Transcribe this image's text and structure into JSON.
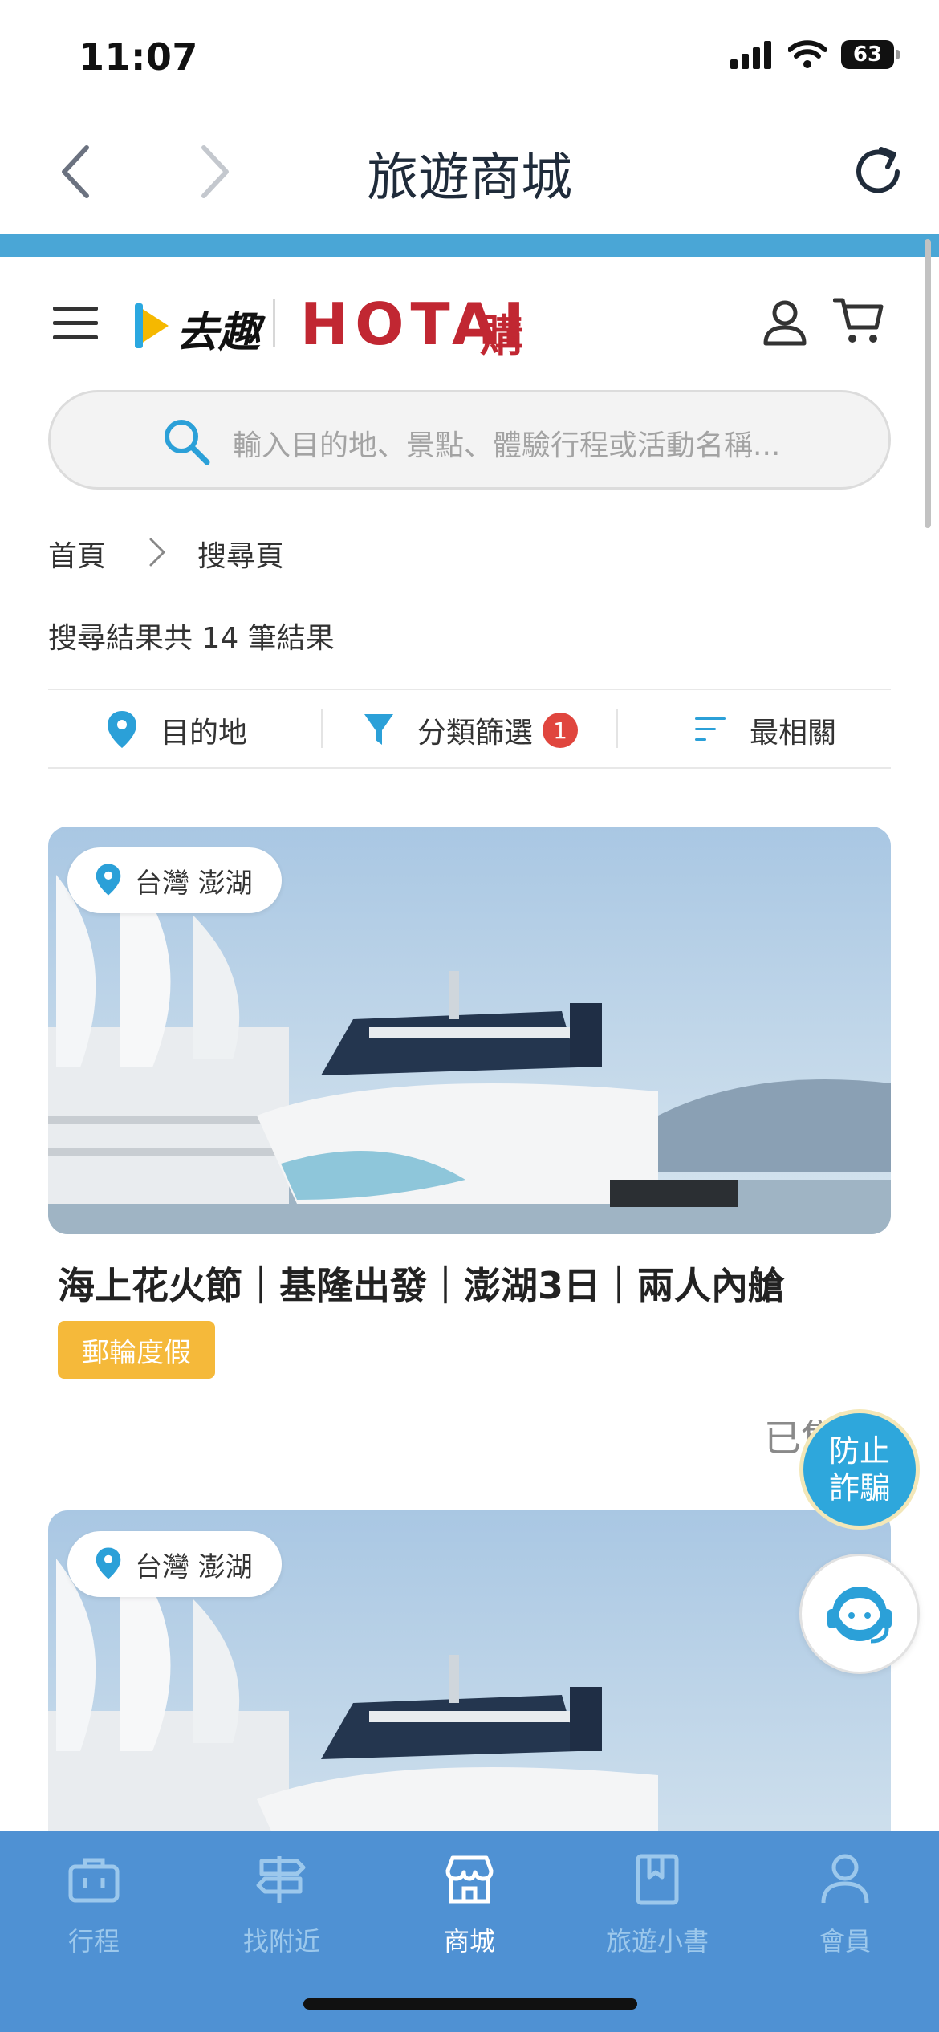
{
  "status_bar": {
    "time": "11:07",
    "battery": "63"
  },
  "nav": {
    "title": "旅遊商城"
  },
  "header": {
    "logo_qq": "去趣",
    "logo_hotai": "HOTAI",
    "logo_hotai_suffix": "購"
  },
  "search": {
    "placeholder": "輸入目的地、景點、體驗行程或活動名稱..."
  },
  "breadcrumb": {
    "home": "首頁",
    "current": "搜尋頁"
  },
  "results": {
    "summary": "搜尋結果共 14 筆結果"
  },
  "filters": {
    "destination": "目的地",
    "category": "分類篩選",
    "category_badge": "1",
    "sort": "最相關"
  },
  "cards": [
    {
      "location": "台灣 澎湖",
      "title": "海上花火節｜基隆出發｜澎湖3日｜兩人內艙",
      "tag": "郵輪度假",
      "sold": "已售"
    },
    {
      "location": "台灣 澎湖"
    }
  ],
  "floating": {
    "fraud_line1": "防止",
    "fraud_line2": "詐騙"
  },
  "tabbar": {
    "tabs": [
      {
        "label": "行程",
        "icon": "briefcase-icon"
      },
      {
        "label": "找附近",
        "icon": "signpost-icon"
      },
      {
        "label": "商城",
        "icon": "store-icon"
      },
      {
        "label": "旅遊小書",
        "icon": "book-icon"
      },
      {
        "label": "會員",
        "icon": "person-icon"
      }
    ],
    "active": "商城"
  },
  "colors": {
    "accent": "#4aa6d6",
    "tabbar": "#4f91d3",
    "brand_red": "#c12732",
    "tag": "#f5b93a"
  }
}
